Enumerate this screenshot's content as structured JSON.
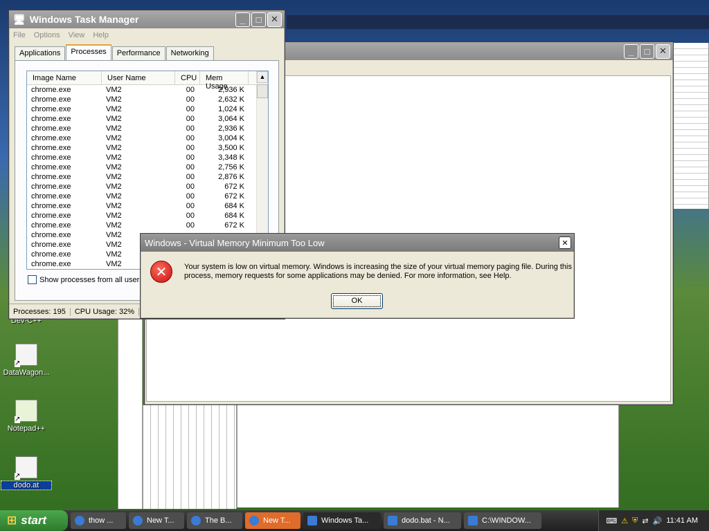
{
  "desktop": {
    "icons": [
      {
        "label": "Dev-C++"
      },
      {
        "label": "DataWagon..."
      },
      {
        "label": "Notepad++"
      },
      {
        "label": "dodo.at"
      }
    ]
  },
  "taskmgr": {
    "title": "Windows Task Manager",
    "menu": [
      "File",
      "Options",
      "View",
      "Help"
    ],
    "tabs": [
      "Applications",
      "Processes",
      "Performance",
      "Networking"
    ],
    "columns": [
      "Image Name",
      "User Name",
      "CPU",
      "Mem Usage"
    ],
    "rows": [
      {
        "name": "chrome.exe",
        "user": "VM2",
        "cpu": "00",
        "mem": "2,936 K"
      },
      {
        "name": "chrome.exe",
        "user": "VM2",
        "cpu": "00",
        "mem": "2,632 K"
      },
      {
        "name": "chrome.exe",
        "user": "VM2",
        "cpu": "00",
        "mem": "1,024 K"
      },
      {
        "name": "chrome.exe",
        "user": "VM2",
        "cpu": "00",
        "mem": "3,064 K"
      },
      {
        "name": "chrome.exe",
        "user": "VM2",
        "cpu": "00",
        "mem": "2,936 K"
      },
      {
        "name": "chrome.exe",
        "user": "VM2",
        "cpu": "00",
        "mem": "3,004 K"
      },
      {
        "name": "chrome.exe",
        "user": "VM2",
        "cpu": "00",
        "mem": "3,500 K"
      },
      {
        "name": "chrome.exe",
        "user": "VM2",
        "cpu": "00",
        "mem": "3,348 K"
      },
      {
        "name": "chrome.exe",
        "user": "VM2",
        "cpu": "00",
        "mem": "2,756 K"
      },
      {
        "name": "chrome.exe",
        "user": "VM2",
        "cpu": "00",
        "mem": "2,876 K"
      },
      {
        "name": "chrome.exe",
        "user": "VM2",
        "cpu": "00",
        "mem": "672 K"
      },
      {
        "name": "chrome.exe",
        "user": "VM2",
        "cpu": "00",
        "mem": "672 K"
      },
      {
        "name": "chrome.exe",
        "user": "VM2",
        "cpu": "00",
        "mem": "684 K"
      },
      {
        "name": "chrome.exe",
        "user": "VM2",
        "cpu": "00",
        "mem": "684 K"
      },
      {
        "name": "chrome.exe",
        "user": "VM2",
        "cpu": "00",
        "mem": "672 K"
      },
      {
        "name": "chrome.exe",
        "user": "VM2",
        "cpu": "",
        "mem": ""
      },
      {
        "name": "chrome.exe",
        "user": "VM2",
        "cpu": "",
        "mem": ""
      },
      {
        "name": "chrome.exe",
        "user": "VM2",
        "cpu": "",
        "mem": ""
      },
      {
        "name": "chrome.exe",
        "user": "VM2",
        "cpu": "",
        "mem": ""
      }
    ],
    "show_all_label": "Show processes from all users",
    "status_processes": "Processes: 195",
    "status_cpu": "CPU Usage: 32%"
  },
  "error_dialog": {
    "title": "Windows - Virtual Memory Minimum Too Low",
    "message": "Your system is low on virtual memory. Windows is increasing the size of your virtual memory paging file. During this process, memory requests for some applications may be denied. For more information, see Help.",
    "ok_label": "OK",
    "close_glyph": "✕"
  },
  "taskbar": {
    "start_label": "start",
    "tasks": [
      {
        "label": "thow ..."
      },
      {
        "label": "New T..."
      },
      {
        "label": "The B..."
      },
      {
        "label": "New T..."
      },
      {
        "label": "Windows Ta..."
      },
      {
        "label": "dodo.bat - N..."
      },
      {
        "label": "C:\\WINDOW..."
      }
    ],
    "clock": "11:41 AM"
  }
}
